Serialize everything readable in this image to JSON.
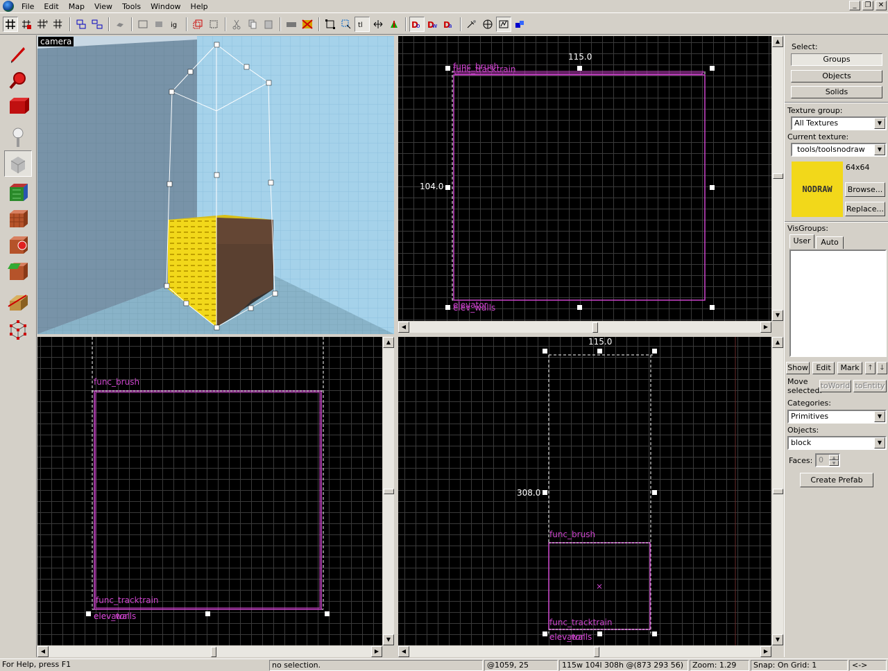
{
  "menu": [
    "File",
    "Edit",
    "Map",
    "View",
    "Tools",
    "Window",
    "Help"
  ],
  "window_controls": [
    "_",
    "❐",
    "✕"
  ],
  "toolbar_icons": [
    "grid-toggle-icon",
    "grid-3d-icon",
    "grid-larger-icon",
    "grid-smaller-icon",
    "group-icon",
    "ungroup-icon",
    "carve-icon",
    "hollow-icon",
    "ignore-groups-icon",
    "to-world-icon",
    "to-entity-icon",
    "cut-icon",
    "copy-icon",
    "paste-icon",
    "texture-lock-icon",
    "check-problems-icon",
    "select-box-icon",
    "select-all-icon",
    "texture-lock-text-icon",
    "flip-icon",
    "apply-icon",
    "displacement-icon",
    "compile-icon",
    "run-map-icon",
    "cordon-icon",
    "show-brush-icon",
    "hide-icon",
    "show-help-icon"
  ],
  "tool_palette": [
    "selection-tool-icon",
    "magnify-tool-icon",
    "camera-tool-icon",
    "entity-tool-icon",
    "block-tool-icon",
    "texture-application-icon",
    "apply-texture-icon",
    "decal-tool-icon",
    "overlay-tool-icon",
    "clipping-tool-icon",
    "vertex-tool-icon"
  ],
  "camera_view": {
    "label": "camera"
  },
  "view_top": {
    "dim_top": "115.0",
    "dim_left": "104.0",
    "labels": [
      "func_brush",
      "func_tracktrain",
      "elevator",
      "elev_walls"
    ]
  },
  "view_front": {
    "labels": [
      "func_brush",
      "func_tracktrain",
      "elevator",
      "elev_walls"
    ]
  },
  "view_side": {
    "dim_top": "115.0",
    "dim_left": "308.0",
    "labels": [
      "func_brush",
      "func_tracktrain",
      "elevator",
      "elev_walls"
    ]
  },
  "panel": {
    "select_label": "Select:",
    "groups_button": "Groups",
    "objects_button": "Objects",
    "solids_button": "Solids",
    "texture_group_label": "Texture group:",
    "texture_group_value": "All Textures",
    "current_texture_label": "Current texture:",
    "current_texture_value": "tools/toolsnodraw",
    "texture_preview_text": "NODRAW",
    "texture_size": "64x64",
    "browse_button": "Browse...",
    "replace_button": "Replace...",
    "visgroups_label": "VisGroups:",
    "tab_user": "User",
    "tab_auto": "Auto",
    "show_button": "Show",
    "edit_button": "Edit",
    "mark_button": "Mark",
    "move_selected_label_1": "Move",
    "move_selected_label_2": "selected:",
    "toworld_button": "toWorld",
    "toentity_button": "toEntity",
    "categories_label": "Categories:",
    "categories_value": "Primitives",
    "objects_label": "Objects:",
    "objects_value": "block",
    "faces_label": "Faces:",
    "faces_value": "0",
    "create_prefab_button": "Create Prefab"
  },
  "status": {
    "help": "For Help, press F1",
    "selection": "no selection.",
    "coords": "@1059, 25",
    "size": "115w 104l 308h @(873 293 56)",
    "zoom": "Zoom: 1.29",
    "snap": "Snap: On Grid: 1",
    "arrows": "<->"
  },
  "colors": {
    "background": "#d4d0c8",
    "entity_label": "#cc44cc",
    "grid_bg": "#000000",
    "texture_yellow": "#f2d81a"
  }
}
